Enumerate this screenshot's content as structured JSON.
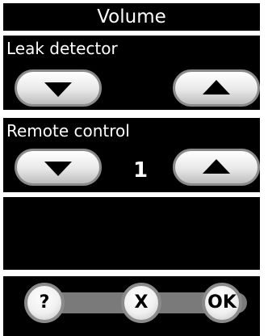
{
  "title": "Volume",
  "leak_detector": {
    "label": "Leak detector"
  },
  "remote_control": {
    "label": "Remote control",
    "value": "1"
  },
  "footer": {
    "help_label": "?",
    "cancel_label": "X",
    "ok_label": "OK"
  },
  "colors": {
    "background": "#000000",
    "text": "#ffffff",
    "button_face": "#f0f0f0",
    "button_border": "#8a8a8a",
    "footer_bar": "#7a7a7a"
  }
}
